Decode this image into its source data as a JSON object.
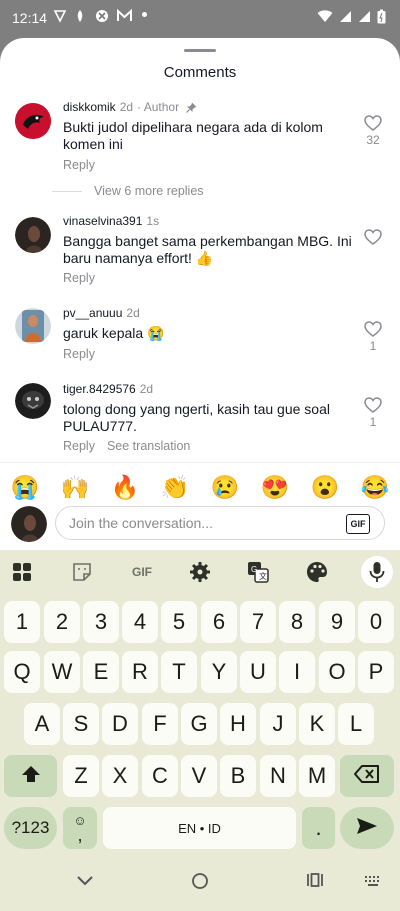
{
  "status_bar": {
    "time": "12:14"
  },
  "sheet": {
    "title": "Comments"
  },
  "comments": [
    {
      "username": "diskkomik",
      "age": "2d",
      "badge": "· Author",
      "text": "Bukti judol dipelihara negara ada di kolom komen ini",
      "reply": "Reply",
      "likes": "32",
      "avatar_color": "#c8102e"
    },
    {
      "username": "vinaselvina391",
      "age": "1s",
      "text": "Bangga banget sama perkembangan MBG. Ini baru namanya effort! 👍",
      "reply": "Reply",
      "likes": "",
      "avatar_color": "#2b2522"
    },
    {
      "username": "pv__anuuu",
      "age": "2d",
      "text": "garuk kepala 😭",
      "reply": "Reply",
      "likes": "1",
      "avatar_color": "#6e8fa8"
    },
    {
      "username": "tiger.8429576",
      "age": "2d",
      "text": "tolong dong yang ngerti, kasih tau gue soal PULAU777.",
      "reply": "Reply",
      "translate": "See translation",
      "likes": "1",
      "avatar_color": "#1d1d1d"
    }
  ],
  "more_replies": "View 6 more replies",
  "emoji_bar": [
    "😭",
    "🙌",
    "🔥",
    "👏",
    "😢",
    "😍",
    "😮",
    "😂"
  ],
  "input": {
    "placeholder": "Join the conversation...",
    "gif_label": "GIF"
  },
  "keyboard": {
    "toolbar_gif": "GIF",
    "rows": [
      [
        "1",
        "2",
        "3",
        "4",
        "5",
        "6",
        "7",
        "8",
        "9",
        "0"
      ],
      [
        "Q",
        "W",
        "E",
        "R",
        "T",
        "Y",
        "U",
        "I",
        "O",
        "P"
      ],
      [
        "A",
        "S",
        "D",
        "F",
        "G",
        "H",
        "J",
        "K",
        "L"
      ],
      [
        "Z",
        "X",
        "C",
        "V",
        "B",
        "N",
        "M"
      ]
    ],
    "symbols_key": "?123",
    "comma_key": ",",
    "space_label": "EN • ID",
    "period_key": ".",
    "emoji_key": "☺"
  },
  "colors": {
    "accent": "#c9dab8",
    "keyboard_bg": "#e8ead6",
    "secondary_text": "#8a8b91"
  }
}
